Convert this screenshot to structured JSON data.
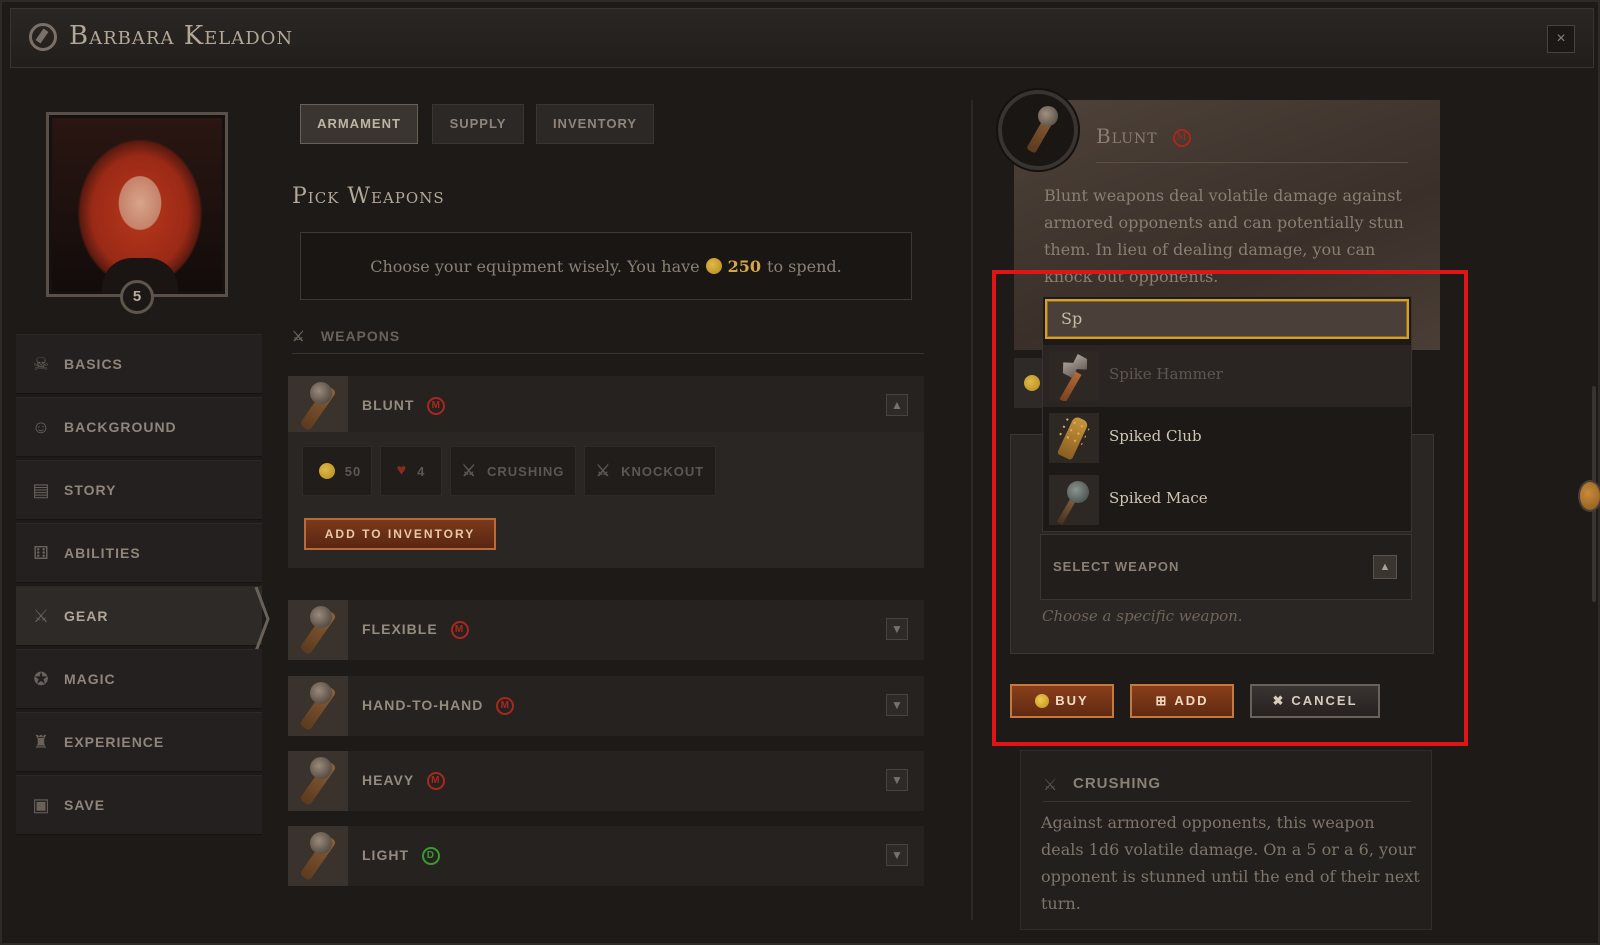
{
  "window": {
    "title": "Barbara Keladon",
    "close_label": "×"
  },
  "sidebar": {
    "level": "5",
    "items": [
      {
        "label": "BASICS",
        "icon": "skull-icon",
        "glyph": "☠"
      },
      {
        "label": "BACKGROUND",
        "icon": "masks-icon",
        "glyph": "☺"
      },
      {
        "label": "STORY",
        "icon": "book-icon",
        "glyph": "▤"
      },
      {
        "label": "ABILITIES",
        "icon": "dice-icon",
        "glyph": "⚅"
      },
      {
        "label": "GEAR",
        "icon": "sword-icon",
        "glyph": "⚔"
      },
      {
        "label": "MAGIC",
        "icon": "pentagram-icon",
        "glyph": "✪"
      },
      {
        "label": "EXPERIENCE",
        "icon": "trophy-icon",
        "glyph": "♜"
      },
      {
        "label": "SAVE",
        "icon": "floppy-icon",
        "glyph": "▣"
      }
    ],
    "active_index": 4
  },
  "tabs": [
    {
      "label": "ARMAMENT",
      "active": true
    },
    {
      "label": "SUPPLY",
      "active": false
    },
    {
      "label": "INVENTORY",
      "active": false
    }
  ],
  "main": {
    "heading": "Pick Weapons",
    "budget_prefix": "Choose your equipment wisely. You have",
    "budget_amount": "250",
    "budget_suffix": "to spend.",
    "weapons_header": "WEAPONS",
    "weapon_rows": [
      {
        "name": "BLUNT",
        "tag": "M",
        "tag_type": "m",
        "expanded": true
      },
      {
        "name": "FLEXIBLE",
        "tag": "M",
        "tag_type": "m",
        "expanded": false
      },
      {
        "name": "HAND-TO-HAND",
        "tag": "M",
        "tag_type": "m",
        "expanded": false
      },
      {
        "name": "HEAVY",
        "tag": "M",
        "tag_type": "m",
        "expanded": false
      },
      {
        "name": "LIGHT",
        "tag": "D",
        "tag_type": "d",
        "expanded": false
      }
    ],
    "blunt_detail": {
      "cost": "50",
      "health": "4",
      "trait_1": "CRUSHING",
      "trait_2": "KNOCKOUT",
      "add_to_inventory_label": "ADD TO INVENTORY"
    }
  },
  "info": {
    "title": "Blunt",
    "tag": "M",
    "description": "Blunt weapons deal volatile damage against armored opponents and can potentially stun them. In lieu of dealing damage, you can knock out opponents."
  },
  "dropdown": {
    "search_value": "Sp",
    "options": [
      {
        "label": "Spike Hammer",
        "icon": "spike-hammer-icon",
        "hovered": true
      },
      {
        "label": "Spiked Club",
        "icon": "spiked-club-icon",
        "hovered": false
      },
      {
        "label": "Spiked Mace",
        "icon": "spiked-mace-icon",
        "hovered": false
      }
    ]
  },
  "config": {
    "select_label": "SELECT WEAPON",
    "select_hint": "Choose a specific weapon.",
    "buy_label": "BUY",
    "add_label": "ADD",
    "cancel_label": "CANCEL"
  },
  "crushing": {
    "title": "CRUSHING",
    "text": "Against armored opponents, this weapon deals 1d6 volatile damage. On a 5 or a 6, your opponent is stunned until the end of their next turn."
  },
  "colors": {
    "accent_gold": "#d4a84a",
    "highlight_red": "#e01414",
    "tag_melee": "#a8281e",
    "tag_distance": "#3a9a30"
  }
}
